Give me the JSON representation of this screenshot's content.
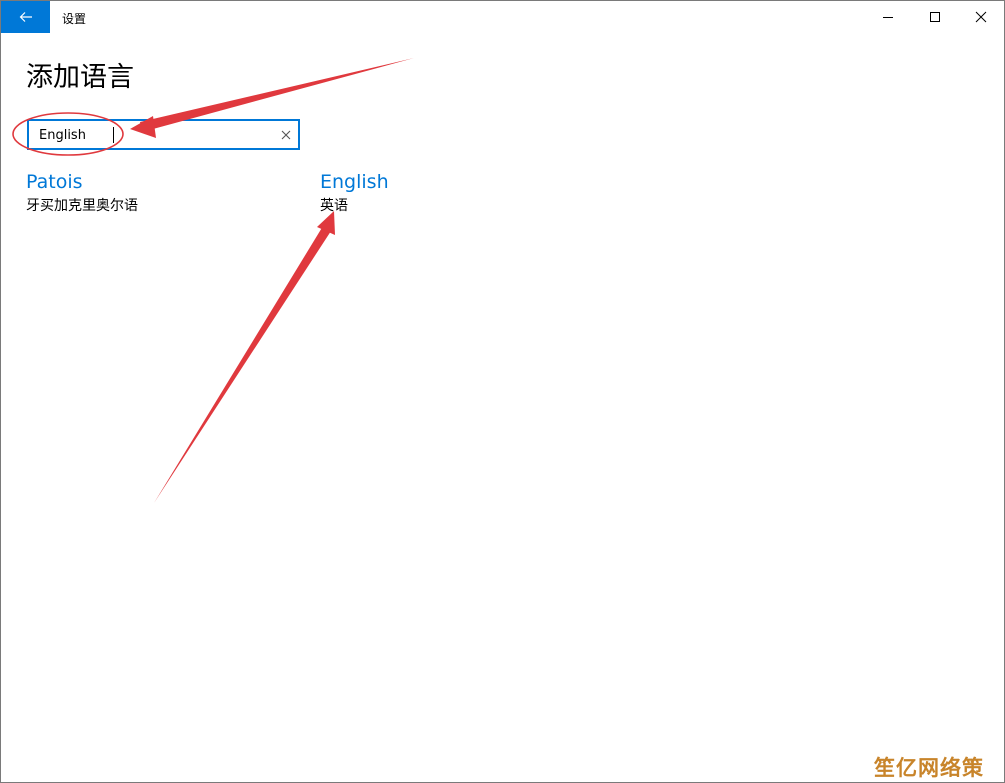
{
  "window": {
    "title": "设置"
  },
  "page": {
    "heading": "添加语言"
  },
  "search": {
    "value": "English",
    "clear_icon": "close-icon"
  },
  "results": [
    {
      "name": "Patois",
      "native": "牙买加克里奥尔语"
    },
    {
      "name": "English",
      "native": "英语"
    }
  ],
  "colors": {
    "accent": "#0078d7",
    "annotation": "#e0393e",
    "watermark": "#c8842a"
  },
  "watermark": {
    "text": "笙亿网络策划"
  }
}
